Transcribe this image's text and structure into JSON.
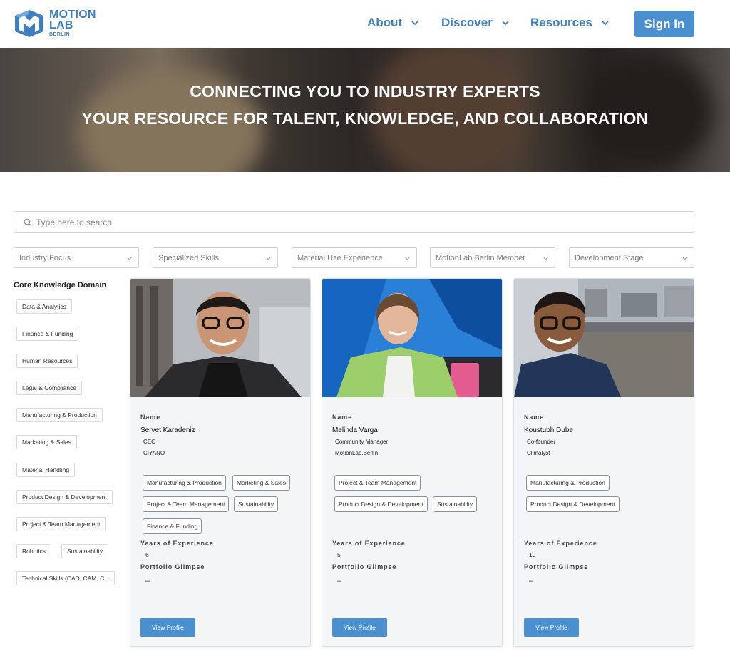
{
  "header": {
    "logo": {
      "line1": "MOTION",
      "line2": "LAB",
      "line3": "BERLIN"
    },
    "nav": [
      {
        "label": "About"
      },
      {
        "label": "Discover"
      },
      {
        "label": "Resources"
      }
    ],
    "sign_in": "Sign In"
  },
  "hero": {
    "line1": "CONNECTING YOU TO INDUSTRY EXPERTS",
    "line2": "YOUR RESOURCE FOR TALENT, KNOWLEDGE, AND COLLABORATION"
  },
  "search": {
    "placeholder": "Type here to search"
  },
  "filters": [
    "Industry Focus",
    "Specialized Skills",
    "Material Use Experience",
    "MotionLab.Berlin Member",
    "Development Stage"
  ],
  "sidebar": {
    "title": "Core Knowledge Domain",
    "domains": [
      "Data & Analytics",
      "Finance & Funding",
      "Human Resources",
      "Legal & Compliance",
      "Manufacturing & Production",
      "Marketing & Sales",
      "Material Handling",
      "Product Design & Development",
      "Project & Team Management",
      "Robotics",
      "Sustainability",
      "Technical Skills (CAD, CAM, C..."
    ]
  },
  "card_labels": {
    "name": "Name",
    "experience": "Years of Experience",
    "portfolio": "Portfolio Glimpse",
    "view_profile": "View Profile"
  },
  "experts": [
    {
      "name": "Servet Karadeniz",
      "role": "CEO",
      "company": "CIYANO",
      "tags": [
        "Manufacturing & Production",
        "Marketing & Sales",
        "Project & Team Management",
        "Sustainability",
        "Finance & Funding"
      ],
      "years": "6",
      "portfolio": "–"
    },
    {
      "name": "Melinda Varga",
      "role": "Community Manager",
      "company": "MotionLab.Berlin",
      "tags": [
        "Project & Team Management",
        "Product Design & Development",
        "Sustainability"
      ],
      "years": "5",
      "portfolio": "–"
    },
    {
      "name": "Koustubh Dube",
      "role": "Co-founder",
      "company": "Climalyst",
      "tags": [
        "Manufacturing & Production",
        "Product Design & Development"
      ],
      "years": "10",
      "portfolio": "–"
    }
  ],
  "colors": {
    "brand": "#3d7fc0",
    "button": "#4a8fd0"
  }
}
